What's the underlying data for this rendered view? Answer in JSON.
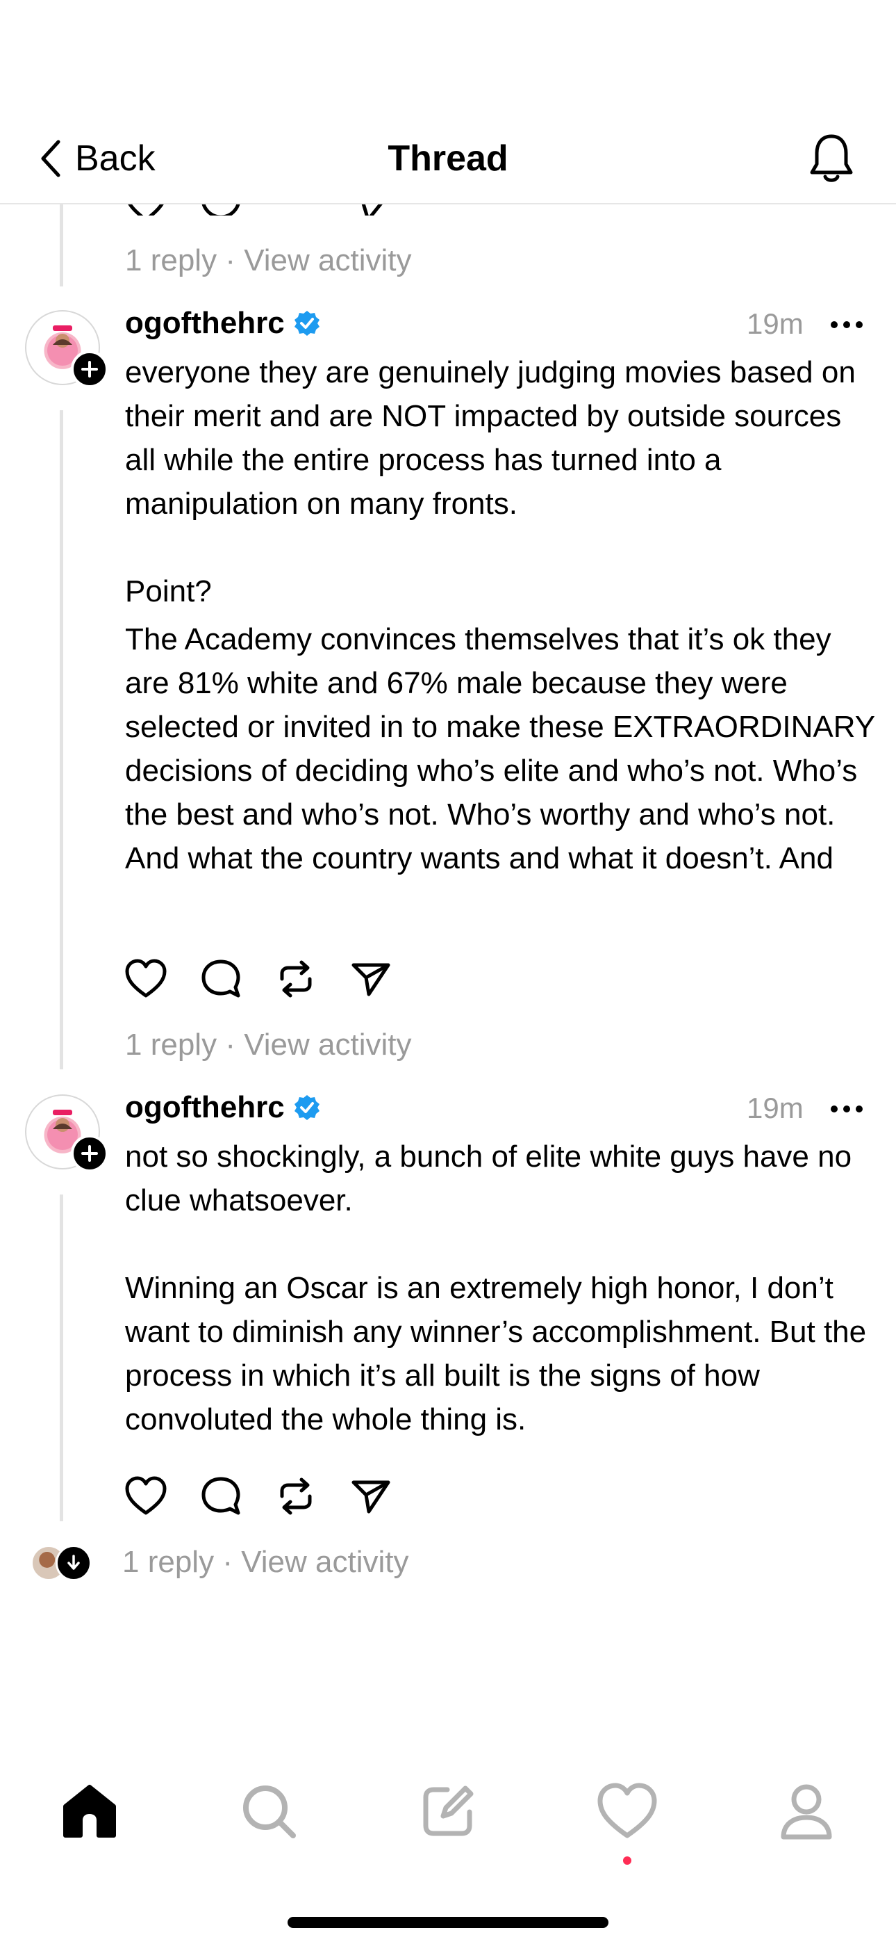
{
  "header": {
    "back_label": "Back",
    "title": "Thread",
    "icons": {
      "back": "chevron-left-icon",
      "notifications": "bell-icon"
    }
  },
  "top_meta": {
    "replies": "1 reply",
    "separator": "·",
    "view_activity": "View activity"
  },
  "posts": [
    {
      "username": "ogofthehrc",
      "verified": true,
      "time": "19m",
      "paragraphs": [
        "everyone they are genuinely judging movies based on their merit and are NOT impacted by outside sources all while the entire process has turned into a manipulation on many fronts.",
        "Point?",
        "The Academy convinces themselves that it’s ok they are 81% white and 67% male because they were selected or invited in to make these EXTRAORDINARY decisions of deciding who’s elite and who’s not. Who’s the best and who’s not. Who’s worthy and who’s not. And what the country wants and what it doesn’t. And"
      ],
      "replies": "1 reply",
      "separator": "·",
      "view_activity": "View activity"
    },
    {
      "username": "ogofthehrc",
      "verified": true,
      "time": "19m",
      "paragraphs": [
        "not so shockingly, a bunch of elite white guys have no clue whatsoever.",
        "Winning an Oscar is an extremely high honor, I don’t want to diminish any winner’s accomplishment. But the process in which it’s all built is the signs of how convoluted the whole thing is."
      ],
      "replies": "1 reply",
      "separator": "·",
      "view_activity": "View activity"
    }
  ],
  "actions": {
    "like": "heart-icon",
    "comment": "comment-icon",
    "repost": "repost-icon",
    "share": "send-icon"
  },
  "tabbar": {
    "home": "home-icon",
    "search": "search-icon",
    "compose": "compose-icon",
    "activity": "heart-icon",
    "profile": "profile-icon"
  },
  "colors": {
    "verified": "#1d9bf0",
    "muted": "#9a9a9a",
    "thread_line": "#e3e3e3",
    "notification_dot": "#ff2d55"
  }
}
